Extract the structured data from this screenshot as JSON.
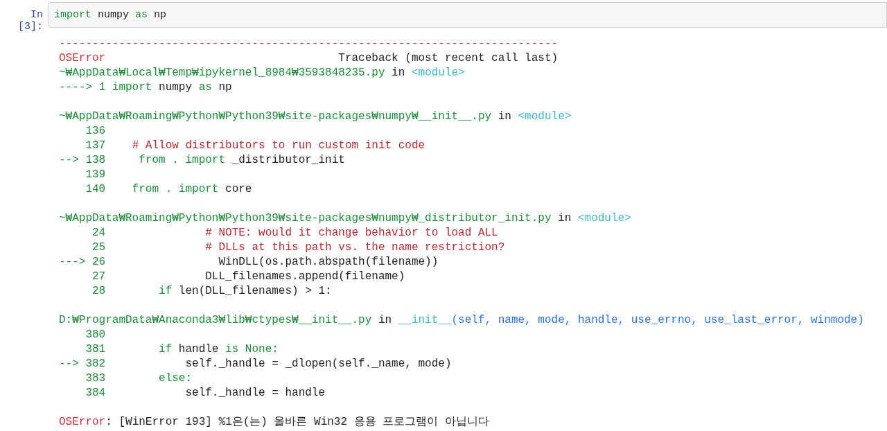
{
  "cell": {
    "prompt": "In [3]:",
    "code": [
      {
        "text": "import",
        "kind": "kw"
      },
      {
        "text": " numpy ",
        "kind": "code"
      },
      {
        "text": "as",
        "kind": "kw"
      },
      {
        "text": " np",
        "kind": "code"
      }
    ]
  },
  "traceback": {
    "rule": "---------------------------------------------------------------------------",
    "header": [
      {
        "text": "OSError",
        "kind": "error"
      },
      {
        "text": "                                   Traceback (most recent call last)",
        "kind": "code"
      }
    ],
    "frames": [
      {
        "lines": [
          [
            {
              "text": "~₩AppData₩Local₩Temp₩ipykernel_8984₩3593848235.py",
              "kind": "path"
            },
            {
              "text": " in ",
              "kind": "code"
            },
            {
              "text": "<module>",
              "kind": "module"
            }
          ],
          [
            {
              "text": "----> 1 import",
              "kind": "kw"
            },
            {
              "text": " numpy ",
              "kind": "code"
            },
            {
              "text": "as",
              "kind": "kw"
            },
            {
              "text": " np",
              "kind": "code"
            }
          ]
        ]
      },
      {
        "lines": [
          [
            {
              "text": "~₩AppData₩Roaming₩Python₩Python39₩site-packages₩numpy₩__init__.py",
              "kind": "path"
            },
            {
              "text": " in ",
              "kind": "code"
            },
            {
              "text": "<module>",
              "kind": "module"
            }
          ],
          [
            {
              "text": "    136",
              "kind": "num"
            }
          ],
          [
            {
              "text": "    137    ",
              "kind": "num"
            },
            {
              "text": "# Allow distributors to run custom init code",
              "kind": "comment"
            }
          ],
          [
            {
              "text": "--> 138     from . import ",
              "kind": "kw"
            },
            {
              "text": "_distributor_init",
              "kind": "code"
            }
          ],
          [
            {
              "text": "    139",
              "kind": "num"
            }
          ],
          [
            {
              "text": "    140    ",
              "kind": "num"
            },
            {
              "text": "from . import ",
              "kind": "kw"
            },
            {
              "text": "core",
              "kind": "code"
            }
          ]
        ]
      },
      {
        "lines": [
          [
            {
              "text": "~₩AppData₩Roaming₩Python₩Python39₩site-packages₩numpy₩_distributor_init.py",
              "kind": "path"
            },
            {
              "text": " in ",
              "kind": "code"
            },
            {
              "text": "<module>",
              "kind": "module"
            }
          ],
          [
            {
              "text": "     24               ",
              "kind": "num"
            },
            {
              "text": "# NOTE: would it change behavior to load ALL",
              "kind": "comment"
            }
          ],
          [
            {
              "text": "     25               ",
              "kind": "num"
            },
            {
              "text": "# DLLs at this path vs. the name restriction?",
              "kind": "comment"
            }
          ],
          [
            {
              "text": "---> 26                 ",
              "kind": "kw"
            },
            {
              "text": "WinDLL(os.path.abspath(filename))",
              "kind": "code"
            }
          ],
          [
            {
              "text": "     27               ",
              "kind": "num"
            },
            {
              "text": "DLL_filenames.append(filename)",
              "kind": "code"
            }
          ],
          [
            {
              "text": "     28        ",
              "kind": "num"
            },
            {
              "text": "if",
              "kind": "kw"
            },
            {
              "text": " len(DLL_filenames) > 1:",
              "kind": "code"
            }
          ]
        ]
      },
      {
        "lines": [
          [
            {
              "text": "D:₩ProgramData₩Anaconda3₩lib₩ctypes₩__init__.py",
              "kind": "path"
            },
            {
              "text": " in ",
              "kind": "code"
            },
            {
              "text": "__init__",
              "kind": "module"
            },
            {
              "text": "(self, name, mode, handle, use_errno, use_last_error, winmode)",
              "kind": "args"
            }
          ],
          [
            {
              "text": "    380",
              "kind": "num"
            }
          ],
          [
            {
              "text": "    381        ",
              "kind": "num"
            },
            {
              "text": "if",
              "kind": "kw"
            },
            {
              "text": " handle ",
              "kind": "code"
            },
            {
              "text": "is None:",
              "kind": "kw"
            }
          ],
          [
            {
              "text": "--> 382            ",
              "kind": "kw"
            },
            {
              "text": "self._handle = _dlopen(self._name, mode)",
              "kind": "code"
            }
          ],
          [
            {
              "text": "    383        ",
              "kind": "num"
            },
            {
              "text": "else:",
              "kind": "kw"
            }
          ],
          [
            {
              "text": "    384            ",
              "kind": "num"
            },
            {
              "text": "self._handle = handle",
              "kind": "code"
            }
          ]
        ]
      }
    ],
    "error": [
      {
        "text": "OSError",
        "kind": "error"
      },
      {
        "text": ": [WinError 193] %1은(는) 올바른 Win32 응용 프로그램이 아닙니다",
        "kind": "code"
      }
    ]
  }
}
